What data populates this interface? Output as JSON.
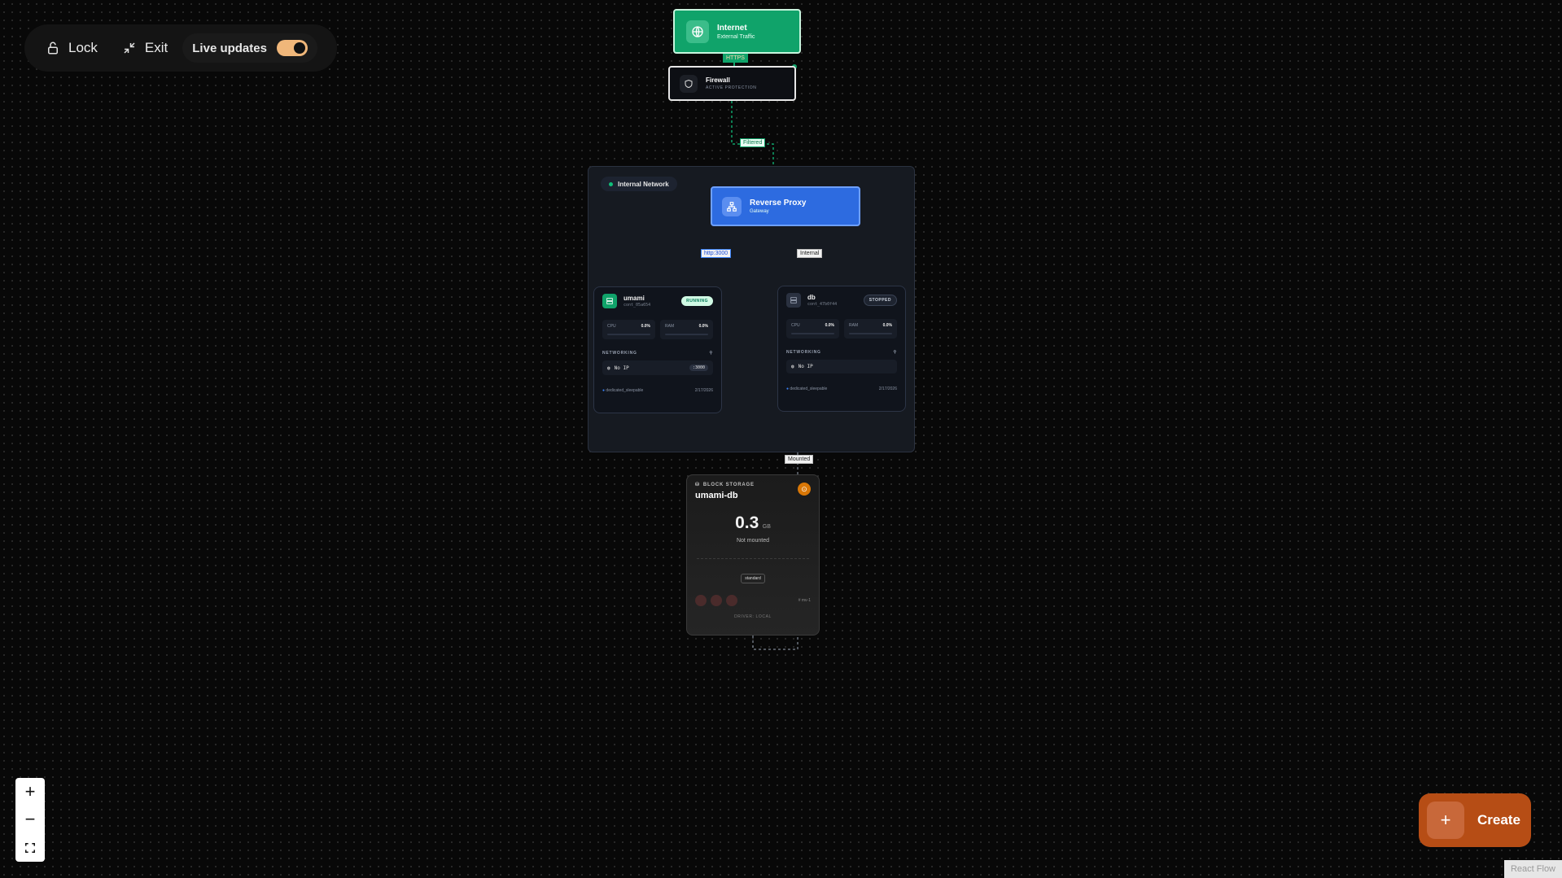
{
  "toolbar": {
    "lock_label": "Lock",
    "exit_label": "Exit",
    "live_label": "Live updates",
    "live_on": true
  },
  "nodes": {
    "internet": {
      "title": "Internet",
      "subtitle": "External Traffic",
      "icon": "globe-icon"
    },
    "firewall": {
      "title": "Firewall",
      "subtitle": "ACTIVE PROTECTION",
      "icon": "shield-icon"
    },
    "network": {
      "label": "Internal Network"
    },
    "proxy": {
      "title": "Reverse Proxy",
      "subtitle": "Gateway",
      "icon": "network-icon"
    }
  },
  "edges": {
    "https": "HTTPS",
    "filtered": "Filtered",
    "http3000": "http:3000",
    "internal": "Internal",
    "mounted": "Mounted"
  },
  "services": [
    {
      "name": "umami",
      "id": "cont_05a654",
      "status": "RUNNING",
      "cpu_label": "CPU",
      "cpu": "0.0%",
      "ram_label": "RAM",
      "ram": "0.0%",
      "networking": "NETWORKING",
      "ip": "No IP",
      "port": ":3000",
      "network": "dedicated_sleepable",
      "date": "2/17/2026"
    },
    {
      "name": "db",
      "id": "cont_47b0f44",
      "status": "STOPPED",
      "cpu_label": "CPU",
      "cpu": "0.0%",
      "ram_label": "RAM",
      "ram": "0.0%",
      "networking": "NETWORKING",
      "ip": "No IP",
      "port": "",
      "network": "dedicated_sleepable",
      "date": "2/17/2026"
    }
  ],
  "storage": {
    "type_label": "BLOCK STORAGE",
    "name": "umami-db",
    "size": "0.3",
    "unit": "GB",
    "state": "Not mounted",
    "tier": "standard",
    "region": "# mv-1",
    "driver": "DRIVER: LOCAL"
  },
  "controls": {
    "create_label": "Create",
    "attribution": "React Flow"
  },
  "colors": {
    "internet": "#10a36a",
    "proxy": "#2d6be0",
    "create": "#b64d15",
    "running": "#6ee7b7",
    "toggle": "#f0b77a"
  }
}
